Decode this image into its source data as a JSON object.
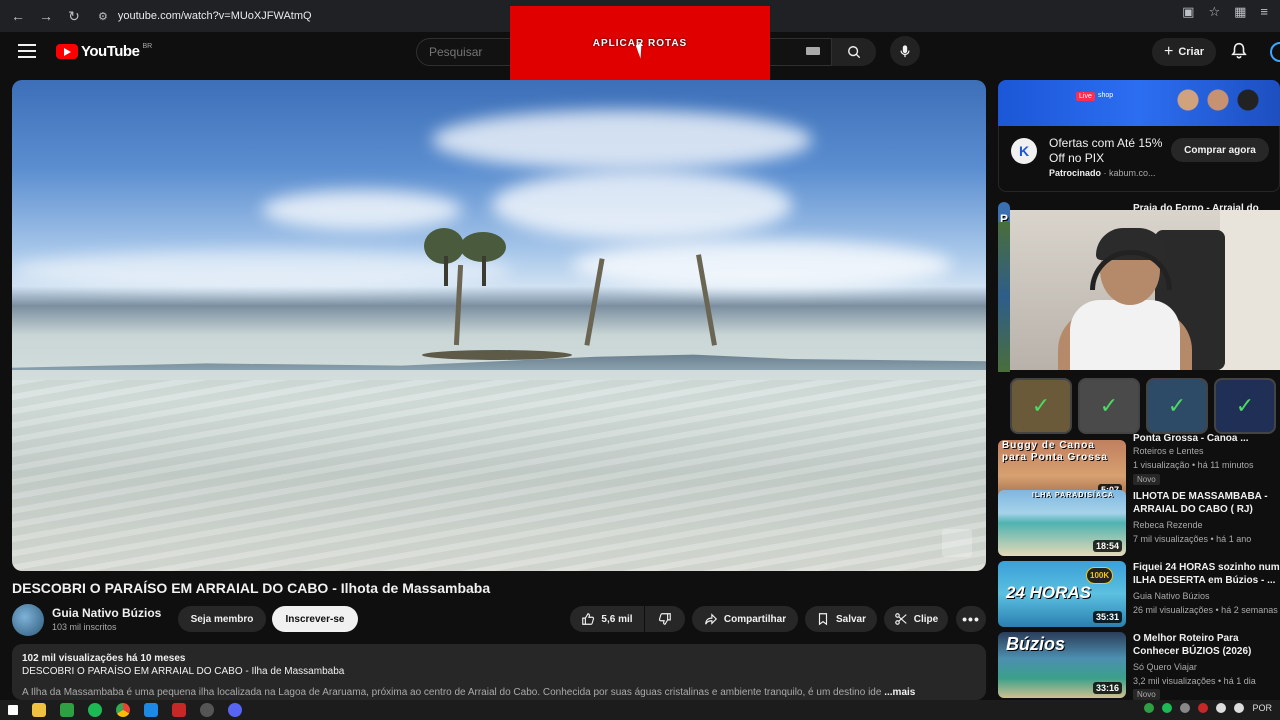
{
  "browser": {
    "url": "youtube.com/watch?v=MUoXJFWAtmQ"
  },
  "header": {
    "logo_text": "YouTube",
    "region": "BR",
    "search_placeholder": "Pesquisar",
    "create_label": "Criar"
  },
  "overlay": {
    "text": "APLICAR ROTAS",
    "color": "#e10000"
  },
  "video": {
    "title": "DESCOBRI O PARAÍSO EM ARRAIAL DO CABO - Ilhota de Massambaba",
    "channel": "Guia Nativo Búzios",
    "subscribers": "103 mil inscritos",
    "member_label": "Seja membro",
    "subscribe_label": "Inscrever-se",
    "likes": "5,6 mil",
    "share_label": "Compartilhar",
    "save_label": "Salvar",
    "clip_label": "Clipe"
  },
  "description": {
    "stats": "102 mil visualizações  há 10 meses",
    "headline": "DESCOBRI O PARAÍSO EM ARRAIAL DO CABO - Ilha de Massambaba",
    "body": "A Ilha da Massambaba é uma pequena ilha localizada na Lagoa de Araruama, próxima ao centro de Arraial do Cabo. Conhecida por suas águas cristalinas e ambiente tranquilo, é um destino ide",
    "more": "...mais"
  },
  "ad": {
    "banner_live": "Live",
    "banner_shop": "shop",
    "title": "Ofertas com Até 15% Off no PIX",
    "sponsored": "Patrocinado",
    "advertiser": "kabum.co...",
    "cta": "Comprar agora",
    "logo_letter": "K"
  },
  "sidebar": {
    "items": [
      {
        "title": "Praia do Forno - Arraial do",
        "channel": "",
        "meta": "",
        "duration": "",
        "thumb_text": "P"
      },
      {
        "title": "Ponta Grossa - Canoa ...",
        "channel": "Roteiros e Lentes",
        "meta": "1 visualização  • há 11 minutos",
        "badge": "Novo",
        "duration": "5:07",
        "thumb_text": "Buggy de Canoa para Ponta Grossa"
      },
      {
        "title": "ILHOTA DE MASSAMBABA - ARRAIAL DO CABO ( RJ)",
        "channel": "Rebeca Rezende",
        "meta": "7 mil visualizações  • há 1 ano",
        "duration": "18:54",
        "thumb_text": "ILHA PARADISÍACA"
      },
      {
        "title": "Fiquei 24 HORAS sozinho num ILHA DESERTA em Búzios - ...",
        "channel": "Guia Nativo Búzios",
        "meta": "26 mil visualizações  • há 2 semanas",
        "duration": "35:31",
        "thumb_text": "24 HORAS",
        "thumb_badge": "100K"
      },
      {
        "title": "O Melhor Roteiro Para Conhecer BÚZIOS (2026)",
        "channel": "Só Quero Viajar",
        "meta": "3,2 mil visualizações  • há 1 dia",
        "badge": "Novo",
        "duration": "33:16",
        "thumb_text": "Búzios"
      }
    ]
  },
  "taskbar": {
    "lang": "POR"
  }
}
